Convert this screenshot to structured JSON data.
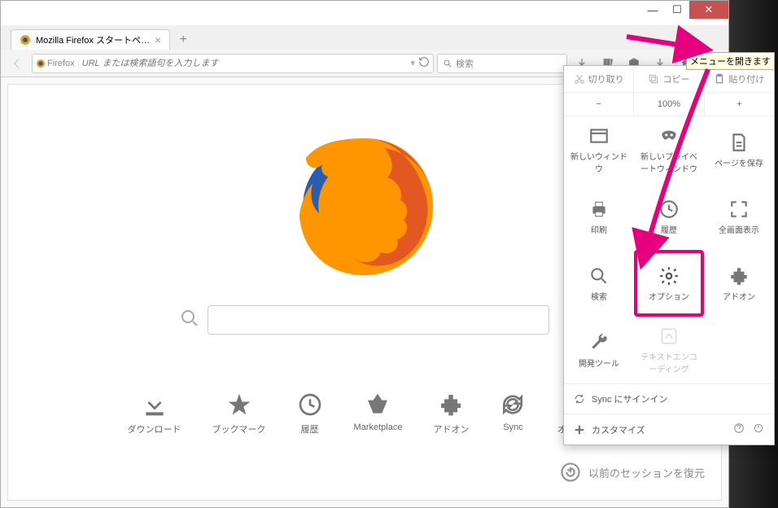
{
  "window": {
    "tab_title": "Mozilla Firefox スタートペ…",
    "identity": "Firefox",
    "url_placeholder": "URL または検索語句を入力します",
    "search_placeholder": "検索"
  },
  "tooltip": "メニューを開きます",
  "menu": {
    "edit": {
      "cut": "切り取り",
      "copy": "コピー",
      "paste": "貼り付け"
    },
    "zoom": {
      "minus": "−",
      "level": "100%",
      "plus": "+"
    },
    "items": [
      {
        "label": "新しいウィンドウ"
      },
      {
        "label": "新しいプライベートウィンドウ"
      },
      {
        "label": "ページを保存"
      },
      {
        "label": "印刷"
      },
      {
        "label": "履歴"
      },
      {
        "label": "全画面表示"
      },
      {
        "label": "検索"
      },
      {
        "label": "オプション"
      },
      {
        "label": "アドオン"
      },
      {
        "label": "開発ツール"
      },
      {
        "label": "テキストエンコーディング"
      }
    ],
    "sync": "Sync にサインイン",
    "customize": "カスタマイズ"
  },
  "launchers": [
    {
      "label": "ダウンロード"
    },
    {
      "label": "ブックマーク"
    },
    {
      "label": "履歴"
    },
    {
      "label": "Marketplace"
    },
    {
      "label": "アドオン"
    },
    {
      "label": "Sync"
    },
    {
      "label": "オプション"
    }
  ],
  "restore": "以前のセッションを復元"
}
